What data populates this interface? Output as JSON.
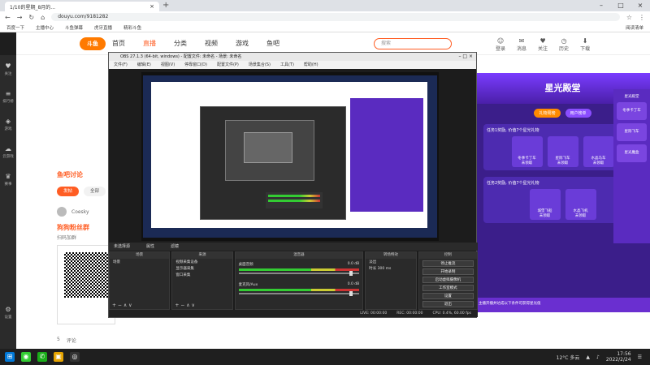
{
  "browser": {
    "tab_title": "1/10的星期_8月的...",
    "url": "douyu.com/9181282",
    "bookmarks": [
      "百度一下",
      "主播中心",
      "斗鱼弹幕",
      "虎牙直播",
      "精彩斗鱼"
    ],
    "bookmarks_right": "阅读清单"
  },
  "site": {
    "logo": "斗鱼",
    "nav_items": [
      "首页",
      "直播",
      "分类",
      "视频",
      "游戏",
      "鱼吧"
    ],
    "search_placeholder": "搜索",
    "header_icons": [
      "登录",
      "消息",
      "关注",
      "历史",
      "下载"
    ]
  },
  "left_sidebar": [
    "关注",
    "排行榜",
    "游戏",
    "云游戏",
    "赛事",
    "设置"
  ],
  "content": {
    "fish_title": "鱼吧讨论",
    "btn_primary": "发帖",
    "btn_secondary": "全部",
    "username": "Coesky",
    "fan_title": "狗狗粉丝群",
    "fan_sub": "扫码加群",
    "like_count": "5",
    "comment_label": "评论"
  },
  "promo": {
    "title": "星光殿堂",
    "tabs": [
      "礼物周榜",
      "用户榜单"
    ],
    "card1_title": "任务1奖励, 价值7个星光礼物",
    "card1_items": [
      "冬季卡丁车",
      "星际飞车",
      "水晶马车"
    ],
    "card2_title": "任务2奖励, 价值7个星光礼物",
    "card2_items": [
      "城堡飞船",
      "水晶飞机"
    ],
    "card_status": "未领取",
    "bottom_text": "主播开播并达成以下条件可获得星光值"
  },
  "side_promo": [
    "星光殿堂",
    "冬季卡丁车",
    "星际飞车",
    "星光魔盒"
  ],
  "obs": {
    "title": "OBS 27.1.3 (64-bit, windows) - 配置文件: 未命名 - 场景: 未命名",
    "menu": [
      "文件(F)",
      "编辑(E)",
      "视图(V)",
      "停靠窗口(D)",
      "配置文件(P)",
      "场景集合(S)",
      "工具(T)",
      "帮助(H)"
    ],
    "scene_bar": [
      "未选择源",
      "属性",
      "滤镜"
    ],
    "docks": {
      "scenes": {
        "header": "场景",
        "items": [
          "场景"
        ]
      },
      "sources": {
        "header": "来源",
        "items": [
          "视频采集设备",
          "显示器采集",
          "窗口采集"
        ]
      },
      "mixer": {
        "header": "混音器",
        "ch1": "桌面音频",
        "ch2": "麦克风/Aux",
        "ch1_db": "0.0 dB",
        "ch2_db": "0.0 dB"
      },
      "transitions": {
        "header": "转场特效",
        "type": "淡出",
        "duration_label": "时长",
        "duration": "300 ms"
      },
      "controls": {
        "header": "控制",
        "buttons": [
          "停止推流",
          "开始录制",
          "启动虚拟摄像机",
          "工作室模式",
          "设置",
          "退出"
        ]
      }
    },
    "status": {
      "live": "LIVE: 00:00:00",
      "rec": "REC: 00:00:00",
      "cpu": "CPU: 0.4%, 60.00 fps"
    },
    "foot_controls": "+  −  ∧  ∨"
  },
  "taskbar": {
    "weather": "12°C 多云",
    "time": "17:56",
    "date": "2022/2/24"
  }
}
